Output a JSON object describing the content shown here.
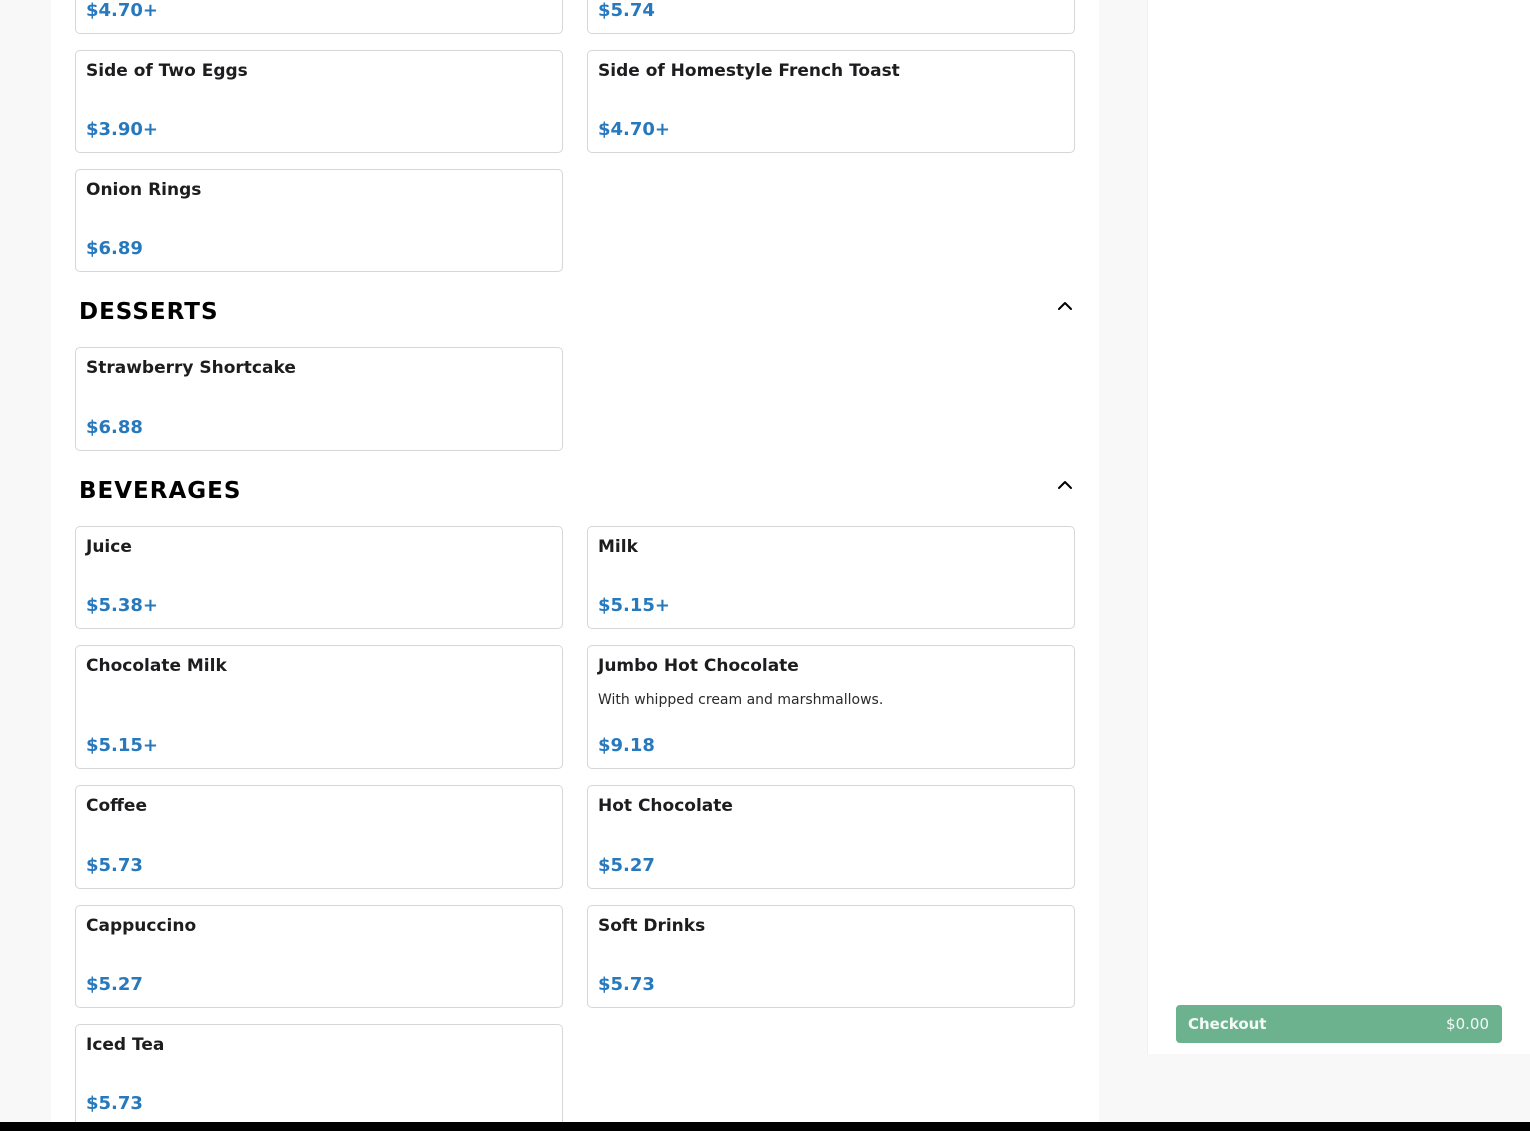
{
  "top_items": [
    {
      "name": "",
      "price": "$4.70+"
    },
    {
      "name": "",
      "price": "$5.74"
    }
  ],
  "sides": [
    {
      "name": "Side of Two Eggs",
      "price": "$3.90+"
    },
    {
      "name": "Side of Homestyle French Toast",
      "price": "$4.70+"
    },
    {
      "name": "Onion Rings",
      "price": "$6.89"
    }
  ],
  "desserts": {
    "title": "DESSERTS",
    "items": [
      {
        "name": "Strawberry Shortcake",
        "price": "$6.88"
      }
    ]
  },
  "beverages": {
    "title": "BEVERAGES",
    "items": [
      {
        "name": "Juice",
        "price": "$5.38+"
      },
      {
        "name": "Milk",
        "price": "$5.15+"
      },
      {
        "name": "Chocolate Milk",
        "price": "$5.15+"
      },
      {
        "name": "Jumbo Hot Chocolate",
        "description": "With whipped cream and marshmallows.",
        "price": "$9.18"
      },
      {
        "name": "Coffee",
        "price": "$5.73"
      },
      {
        "name": "Hot Chocolate",
        "price": "$5.27"
      },
      {
        "name": "Cappuccino",
        "price": "$5.27"
      },
      {
        "name": "Soft Drinks",
        "price": "$5.73"
      },
      {
        "name": "Iced Tea",
        "price": "$5.73"
      }
    ]
  },
  "icons": {
    "collapse": "chevron-up-icon"
  },
  "cart": {
    "checkout_label": "Checkout",
    "total": "$0.00"
  },
  "colors": {
    "price": "#2779be",
    "checkout_button": "#6cb28f",
    "card_border": "#d6d6d6"
  }
}
